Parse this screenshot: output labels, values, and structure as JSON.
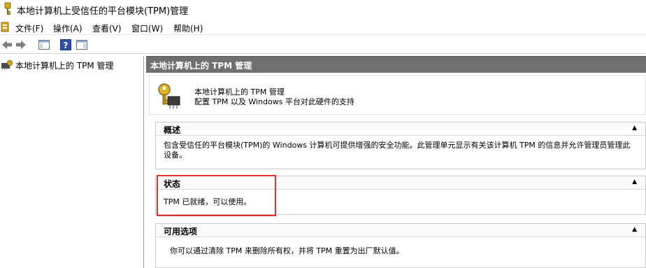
{
  "window": {
    "title": "本地计算机上受信任的平台模块(TPM)管理"
  },
  "menu": {
    "items": [
      "文件(F)",
      "操作(A)",
      "查看(V)",
      "窗口(W)",
      "帮助(H)"
    ]
  },
  "toolbar": {
    "icons": [
      "back-icon",
      "forward-icon",
      "show-hide-console-tree-icon",
      "help-icon",
      "show-hide-action-pane-icon"
    ]
  },
  "tree": {
    "root_label": "本地计算机上的 TPM 管理"
  },
  "content": {
    "header_title": "本地计算机上的 TPM 管理",
    "banner_title": "本地计算机上的 TPM 管理",
    "banner_subtitle": "配置 TPM 以及 Windows 平台对此硬件的支持",
    "sections": [
      {
        "title": "概述",
        "body": "包含受信任的平台模块(TPM)的 Windows 计算机可提供增强的安全功能。此管理单元显示有关该计算机 TPM 的信息并允许管理员管理此设备。"
      },
      {
        "title": "状态",
        "body": "TPM 已就绪，可以使用。"
      },
      {
        "title": "可用选项",
        "body": "你可以通过清除 TPM 来删除所有权，并将 TPM 重置为出厂默认值。"
      }
    ],
    "collapse_glyph": "▲"
  },
  "colors": {
    "header_bg": "#6f6f6f",
    "highlight": "#e03030"
  }
}
